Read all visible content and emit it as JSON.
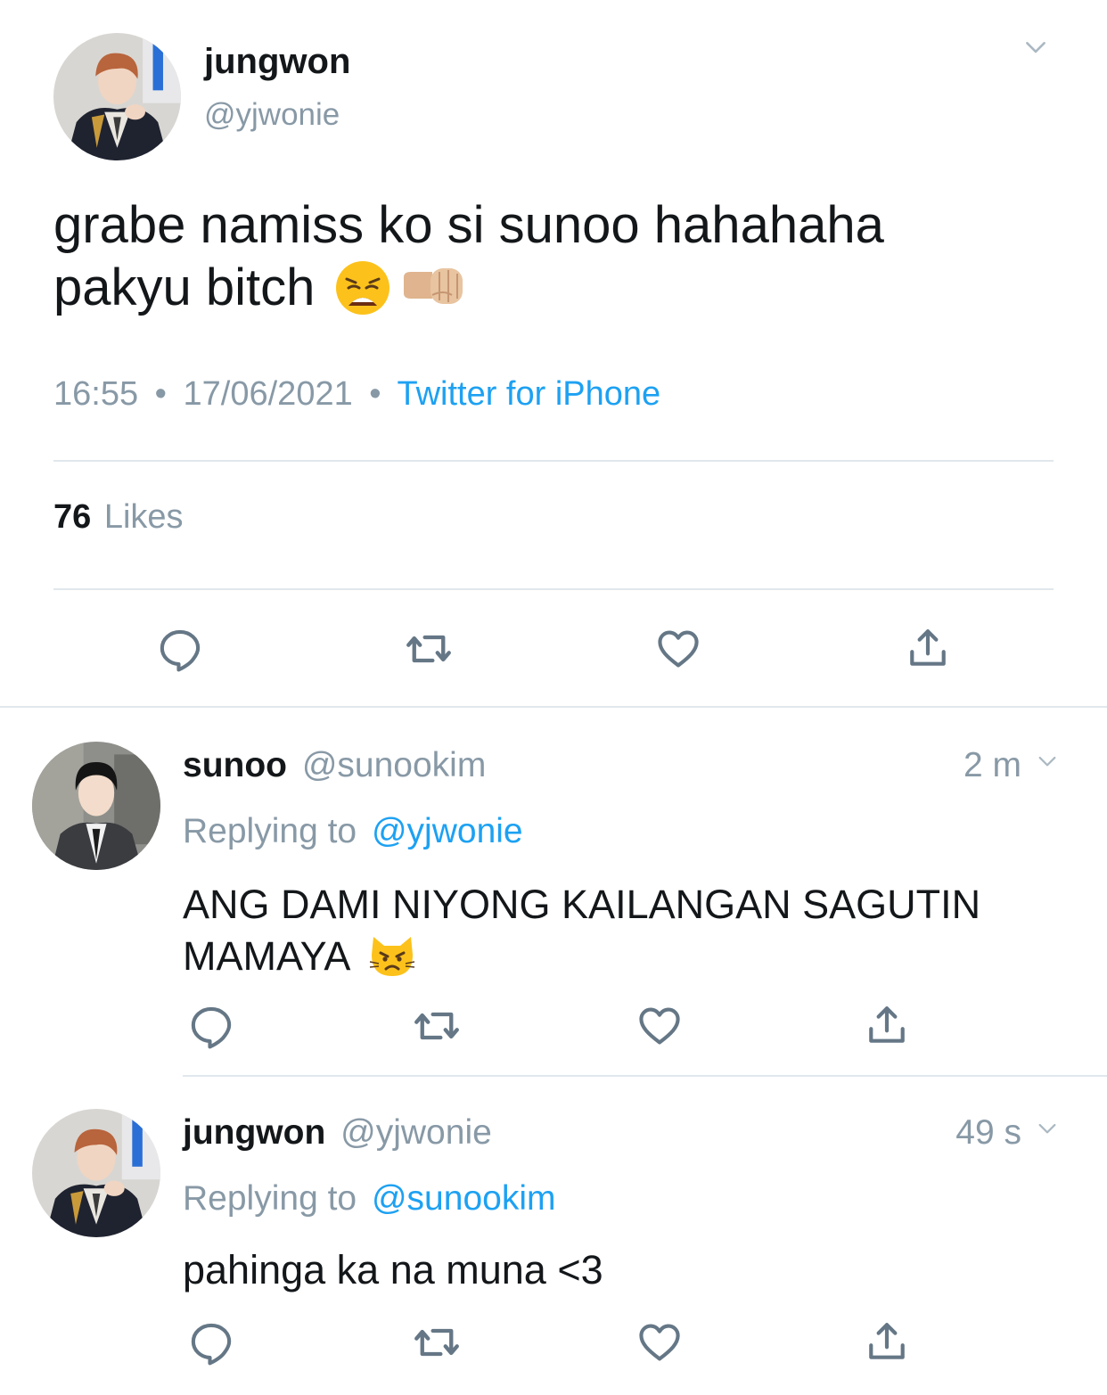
{
  "main_tweet": {
    "display_name": "jungwon",
    "handle": "@yjwonie",
    "text_line1": "grabe namiss ko si sunoo hahahaha",
    "text_line2": "pakyu bitch",
    "emojis": [
      "weary-face",
      "left-facing-fist-medium-light"
    ],
    "time": "16:55",
    "separator": "•",
    "date": "17/06/2021",
    "source": "Twitter for iPhone",
    "likes_count": "76",
    "likes_label": "Likes",
    "actions": [
      "reply-icon",
      "retweet-icon",
      "like-icon",
      "share-icon"
    ]
  },
  "replies": [
    {
      "display_name": "sunoo",
      "handle": "@sunookim",
      "time_ago": "2 m",
      "replying_prefix": "Replying to",
      "replying_to": "@yjwonie",
      "text_line1": "ANG DAMI NIYONG KAILANGAN SAGUTIN",
      "text_line2": "MAMAYA",
      "emojis": [
        "pouting-cat-face"
      ]
    },
    {
      "display_name": "jungwon",
      "handle": "@yjwonie",
      "time_ago": "49 s",
      "replying_prefix": "Replying to",
      "replying_to": "@sunookim",
      "text_line1": "pahinga ka na muna <3"
    }
  ],
  "colors": {
    "text": "#14171a",
    "secondary": "#8899a6",
    "accent": "#1da1f2",
    "divider": "#e1e8ed",
    "icon": "#657786"
  }
}
